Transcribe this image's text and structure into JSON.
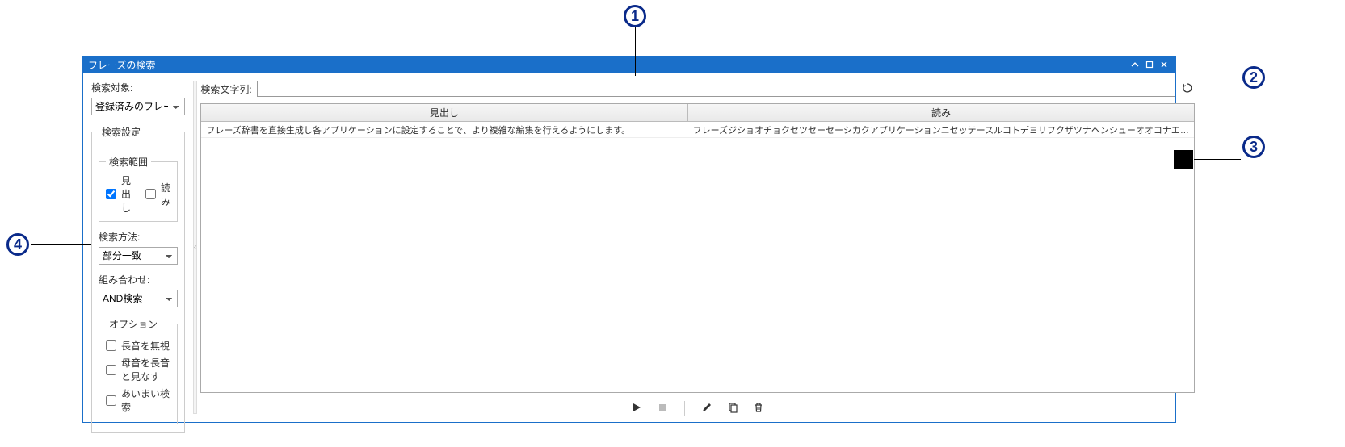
{
  "window": {
    "title": "フレーズの検索"
  },
  "left": {
    "search_target_label": "検索対象:",
    "search_target_value": "登録済みのフレーズ",
    "search_settings_legend": "検索設定",
    "scope_legend": "検索範囲",
    "scope_midashi_label": "見出し",
    "scope_midashi_checked": true,
    "scope_yomi_label": "読み",
    "scope_yomi_checked": false,
    "method_label": "検索方法:",
    "method_value": "部分一致",
    "combo_label": "組み合わせ:",
    "combo_value": "AND検索",
    "options_legend": "オプション",
    "opt_chouon_label": "長音を無視",
    "opt_chouon_checked": false,
    "opt_boin_label": "母音を長音と見なす",
    "opt_boin_checked": false,
    "opt_aimai_label": "あいまい検索",
    "opt_aimai_checked": false
  },
  "right": {
    "search_string_label": "検索文字列:",
    "search_string_value": "",
    "col_midashi": "見出し",
    "col_yomi": "読み",
    "rows": [
      {
        "midashi": "フレーズ辞書を直接生成し各アプリケーションに設定することで、より複雑な編集を行えるようにします。",
        "yomi": "フレーズジショオチョクセツセーセーシカクアプリケーションニセッテースルコトデヨリフクザツナヘンシューオオコナエルヨーニシマス"
      }
    ]
  },
  "callouts": {
    "c1": "1",
    "c2": "2",
    "c3": "3",
    "c4": "4"
  }
}
